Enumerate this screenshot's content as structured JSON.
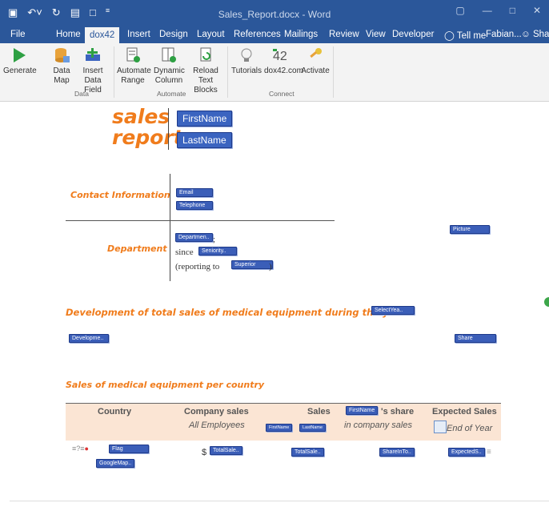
{
  "window": {
    "title": "Sales_Report.docx - Word",
    "minimize_icon": "minimize-icon",
    "maximize_icon": "maximize-icon",
    "close_icon": "close-icon"
  },
  "quick_access": {
    "save_icon": "save-icon",
    "undo_icon": "undo-icon",
    "redo_icon": "redo-icon",
    "open_icon": "folder-icon",
    "new_icon": "new-doc-icon"
  },
  "tabs": [
    "File",
    "Home",
    "dox42",
    "Insert",
    "Design",
    "Layout",
    "References",
    "Mailings",
    "Review",
    "View",
    "Developer"
  ],
  "tell_me": "Tell me",
  "user": "Fabian...",
  "share": "Share",
  "ribbon": {
    "generate": "Generate",
    "data_map": [
      "Data",
      "Map"
    ],
    "insert_data_field": [
      "Insert",
      "Data Field"
    ],
    "automate_range": [
      "Automate",
      "Range"
    ],
    "dynamic_column": [
      "Dynamic",
      "Column"
    ],
    "reload_text_blocks": [
      "Reload",
      "Text Blocks"
    ],
    "tutorials": "Tutorials",
    "dox42_com": "dox42.com",
    "activate": "Activate",
    "groups": {
      "data": "Data",
      "automate": "Automate",
      "connect": "Connect"
    }
  },
  "document": {
    "heading_line1": "sales",
    "heading_line2": "report",
    "firstname": "FirstName",
    "lastname": "LastName",
    "contact_label": "Contact Information",
    "email": "Email",
    "telephone": "Telephone",
    "department_label": "Department",
    "department_field": "Departmen..",
    "department_suffix": ";",
    "since": "since",
    "seniority_field": "Seniority..",
    "reporting_to": "(reporting to",
    "superior_field": "Superior",
    "reporting_close": ")",
    "picture_field": "Picture",
    "development_heading": "Development of total sales of medical equipment during the year",
    "select_year_field": "SelectYea..",
    "development_field": "Developme..",
    "share_field": "Share",
    "country_heading": "Sales of medical equipment per country",
    "table": {
      "col_country": "Country",
      "col_company_sales": "Company sales",
      "col_all_employees": "All Employees",
      "col_sales": "Sales",
      "firstname_small": "FirstName",
      "lastname_small": "LastName",
      "share_firstname": "FirstName",
      "share_suffix": "'s share",
      "in_company_sales": "in company sales",
      "col_expected": "Expected Sales",
      "end_of_year": "End of Year",
      "flag_field": "Flag",
      "googlemap_field": "GoogleMap..",
      "dollar": "$",
      "totalsales1": "TotalSale..",
      "totalsales2": "TotalSale..",
      "sharein_field": "ShareInTo..",
      "expected_field": "ExpectedS.."
    }
  }
}
